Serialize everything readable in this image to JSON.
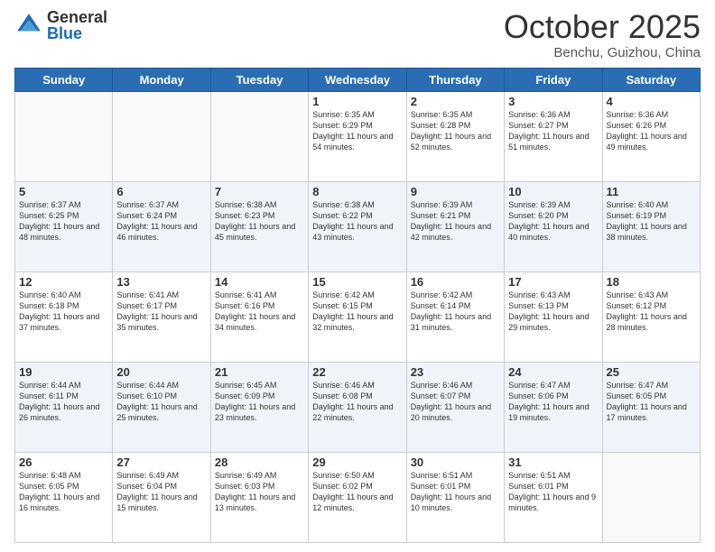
{
  "logo": {
    "general": "General",
    "blue": "Blue"
  },
  "header": {
    "month": "October 2025",
    "location": "Benchu, Guizhou, China"
  },
  "weekdays": [
    "Sunday",
    "Monday",
    "Tuesday",
    "Wednesday",
    "Thursday",
    "Friday",
    "Saturday"
  ],
  "weeks": [
    [
      {
        "day": "",
        "sunrise": "",
        "sunset": "",
        "daylight": "",
        "empty": true
      },
      {
        "day": "",
        "sunrise": "",
        "sunset": "",
        "daylight": "",
        "empty": true
      },
      {
        "day": "",
        "sunrise": "",
        "sunset": "",
        "daylight": "",
        "empty": true
      },
      {
        "day": "1",
        "sunrise": "Sunrise: 6:35 AM",
        "sunset": "Sunset: 6:29 PM",
        "daylight": "Daylight: 11 hours and 54 minutes."
      },
      {
        "day": "2",
        "sunrise": "Sunrise: 6:35 AM",
        "sunset": "Sunset: 6:28 PM",
        "daylight": "Daylight: 11 hours and 52 minutes."
      },
      {
        "day": "3",
        "sunrise": "Sunrise: 6:36 AM",
        "sunset": "Sunset: 6:27 PM",
        "daylight": "Daylight: 11 hours and 51 minutes."
      },
      {
        "day": "4",
        "sunrise": "Sunrise: 6:36 AM",
        "sunset": "Sunset: 6:26 PM",
        "daylight": "Daylight: 11 hours and 49 minutes."
      }
    ],
    [
      {
        "day": "5",
        "sunrise": "Sunrise: 6:37 AM",
        "sunset": "Sunset: 6:25 PM",
        "daylight": "Daylight: 11 hours and 48 minutes."
      },
      {
        "day": "6",
        "sunrise": "Sunrise: 6:37 AM",
        "sunset": "Sunset: 6:24 PM",
        "daylight": "Daylight: 11 hours and 46 minutes."
      },
      {
        "day": "7",
        "sunrise": "Sunrise: 6:38 AM",
        "sunset": "Sunset: 6:23 PM",
        "daylight": "Daylight: 11 hours and 45 minutes."
      },
      {
        "day": "8",
        "sunrise": "Sunrise: 6:38 AM",
        "sunset": "Sunset: 6:22 PM",
        "daylight": "Daylight: 11 hours and 43 minutes."
      },
      {
        "day": "9",
        "sunrise": "Sunrise: 6:39 AM",
        "sunset": "Sunset: 6:21 PM",
        "daylight": "Daylight: 11 hours and 42 minutes."
      },
      {
        "day": "10",
        "sunrise": "Sunrise: 6:39 AM",
        "sunset": "Sunset: 6:20 PM",
        "daylight": "Daylight: 11 hours and 40 minutes."
      },
      {
        "day": "11",
        "sunrise": "Sunrise: 6:40 AM",
        "sunset": "Sunset: 6:19 PM",
        "daylight": "Daylight: 11 hours and 38 minutes."
      }
    ],
    [
      {
        "day": "12",
        "sunrise": "Sunrise: 6:40 AM",
        "sunset": "Sunset: 6:18 PM",
        "daylight": "Daylight: 11 hours and 37 minutes."
      },
      {
        "day": "13",
        "sunrise": "Sunrise: 6:41 AM",
        "sunset": "Sunset: 6:17 PM",
        "daylight": "Daylight: 11 hours and 35 minutes."
      },
      {
        "day": "14",
        "sunrise": "Sunrise: 6:41 AM",
        "sunset": "Sunset: 6:16 PM",
        "daylight": "Daylight: 11 hours and 34 minutes."
      },
      {
        "day": "15",
        "sunrise": "Sunrise: 6:42 AM",
        "sunset": "Sunset: 6:15 PM",
        "daylight": "Daylight: 11 hours and 32 minutes."
      },
      {
        "day": "16",
        "sunrise": "Sunrise: 6:42 AM",
        "sunset": "Sunset: 6:14 PM",
        "daylight": "Daylight: 11 hours and 31 minutes."
      },
      {
        "day": "17",
        "sunrise": "Sunrise: 6:43 AM",
        "sunset": "Sunset: 6:13 PM",
        "daylight": "Daylight: 11 hours and 29 minutes."
      },
      {
        "day": "18",
        "sunrise": "Sunrise: 6:43 AM",
        "sunset": "Sunset: 6:12 PM",
        "daylight": "Daylight: 11 hours and 28 minutes."
      }
    ],
    [
      {
        "day": "19",
        "sunrise": "Sunrise: 6:44 AM",
        "sunset": "Sunset: 6:11 PM",
        "daylight": "Daylight: 11 hours and 26 minutes."
      },
      {
        "day": "20",
        "sunrise": "Sunrise: 6:44 AM",
        "sunset": "Sunset: 6:10 PM",
        "daylight": "Daylight: 11 hours and 25 minutes."
      },
      {
        "day": "21",
        "sunrise": "Sunrise: 6:45 AM",
        "sunset": "Sunset: 6:09 PM",
        "daylight": "Daylight: 11 hours and 23 minutes."
      },
      {
        "day": "22",
        "sunrise": "Sunrise: 6:46 AM",
        "sunset": "Sunset: 6:08 PM",
        "daylight": "Daylight: 11 hours and 22 minutes."
      },
      {
        "day": "23",
        "sunrise": "Sunrise: 6:46 AM",
        "sunset": "Sunset: 6:07 PM",
        "daylight": "Daylight: 11 hours and 20 minutes."
      },
      {
        "day": "24",
        "sunrise": "Sunrise: 6:47 AM",
        "sunset": "Sunset: 6:06 PM",
        "daylight": "Daylight: 11 hours and 19 minutes."
      },
      {
        "day": "25",
        "sunrise": "Sunrise: 6:47 AM",
        "sunset": "Sunset: 6:05 PM",
        "daylight": "Daylight: 11 hours and 17 minutes."
      }
    ],
    [
      {
        "day": "26",
        "sunrise": "Sunrise: 6:48 AM",
        "sunset": "Sunset: 6:05 PM",
        "daylight": "Daylight: 11 hours and 16 minutes."
      },
      {
        "day": "27",
        "sunrise": "Sunrise: 6:49 AM",
        "sunset": "Sunset: 6:04 PM",
        "daylight": "Daylight: 11 hours and 15 minutes."
      },
      {
        "day": "28",
        "sunrise": "Sunrise: 6:49 AM",
        "sunset": "Sunset: 6:03 PM",
        "daylight": "Daylight: 11 hours and 13 minutes."
      },
      {
        "day": "29",
        "sunrise": "Sunrise: 6:50 AM",
        "sunset": "Sunset: 6:02 PM",
        "daylight": "Daylight: 11 hours and 12 minutes."
      },
      {
        "day": "30",
        "sunrise": "Sunrise: 6:51 AM",
        "sunset": "Sunset: 6:01 PM",
        "daylight": "Daylight: 11 hours and 10 minutes."
      },
      {
        "day": "31",
        "sunrise": "Sunrise: 6:51 AM",
        "sunset": "Sunset: 6:01 PM",
        "daylight": "Daylight: 11 hours and 9 minutes."
      },
      {
        "day": "",
        "sunrise": "",
        "sunset": "",
        "daylight": "",
        "empty": true
      }
    ]
  ]
}
